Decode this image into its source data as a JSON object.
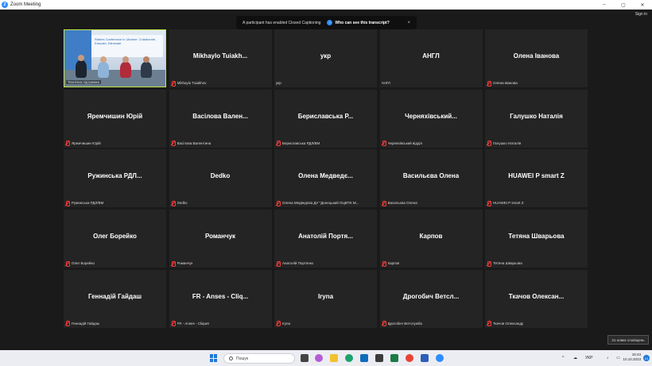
{
  "window": {
    "title": "Zoom Meeting",
    "controls": [
      "–",
      "▢",
      "✕"
    ]
  },
  "header": {
    "signin": "Sign in"
  },
  "notification": {
    "message": "A participant has enabled Closed Captioning",
    "link": "Who can see this transcript?",
    "close": "×"
  },
  "participants": [
    {
      "name": "",
      "label": "Технічна підтримка",
      "video": true,
      "muted": false
    },
    {
      "name": "Mikhaylo  Tuiakh...",
      "label": "Mikhaylo Tuiakhov",
      "muted": true
    },
    {
      "name": "укр",
      "label": "укр",
      "muted": false
    },
    {
      "name": "АНГЛ",
      "label": "АНГЛ",
      "muted": false
    },
    {
      "name": "Олена Іванова",
      "label": "Олена Іванова",
      "muted": true
    },
    {
      "name": "Яремчишин Юрій",
      "label": "Яремчишин Юрій",
      "muted": true
    },
    {
      "name": "Васілова  Вален...",
      "label": "Васілова Валентина",
      "muted": true
    },
    {
      "name": "Бериславська Р...",
      "label": "Бериславська РДЛ/ВМ",
      "muted": true
    },
    {
      "name": "Черняхівський...",
      "label": "Черняхівський відділ",
      "muted": true
    },
    {
      "name": "Галушко Наталія",
      "label": "Галушко Наталія",
      "muted": true
    },
    {
      "name": "Ружинська  РДЛ...",
      "label": "Ружинська РДЛ/ВМ",
      "muted": true
    },
    {
      "name": "Dedko",
      "label": "Dedko",
      "muted": true
    },
    {
      "name": "Олена  Медведє...",
      "label": "Олена Медведєва ДУ \"Донецький ОЦКПХ М...",
      "muted": true
    },
    {
      "name": "Васильєва Олена",
      "label": "Васильєва Олена",
      "muted": true
    },
    {
      "name": "HUAWEI P smart Z",
      "label": "HUAWEI P smart Z",
      "muted": true
    },
    {
      "name": "Олег Борейко",
      "label": "Олег Борейко",
      "muted": true
    },
    {
      "name": "Романчук",
      "label": "Романчук",
      "muted": true
    },
    {
      "name": "Анатолій  Портя...",
      "label": "Анатолій Портянко",
      "muted": true
    },
    {
      "name": "Карпов",
      "label": "Карпов",
      "muted": true
    },
    {
      "name": "Тетяна Шварьова",
      "label": "Тетяна Шварьова",
      "muted": true
    },
    {
      "name": "Геннадій  Гайдаш",
      "label": "Геннадій Гайдаш",
      "muted": true
    },
    {
      "name": "FR  -  Anses  -  Cliq...",
      "label": "FR - Anses - Cliquet",
      "muted": true
    },
    {
      "name": "Iryna",
      "label": "Iryna",
      "muted": true
    },
    {
      "name": "Дрогобич  Ветсл...",
      "label": "Дрогобич Ветслужба",
      "muted": true
    },
    {
      "name": "Ткачов  Олексан...",
      "label": "Ткачов Олександр",
      "muted": true
    }
  ],
  "video_banner": "Rabies Conference in Ukraine: Collaborate, Educate, Eliminate",
  "taskbar": {
    "search_placeholder": "Пошук",
    "language": "УКР",
    "time": "16:43",
    "date": "10.10.2023",
    "notif_count": "21",
    "toast": "21 нових сповіщень"
  },
  "colors": {
    "accent": "#2d8cff",
    "active_speaker": "#c5e64b",
    "muted": "#ff3b3b",
    "tile": "#242424"
  }
}
